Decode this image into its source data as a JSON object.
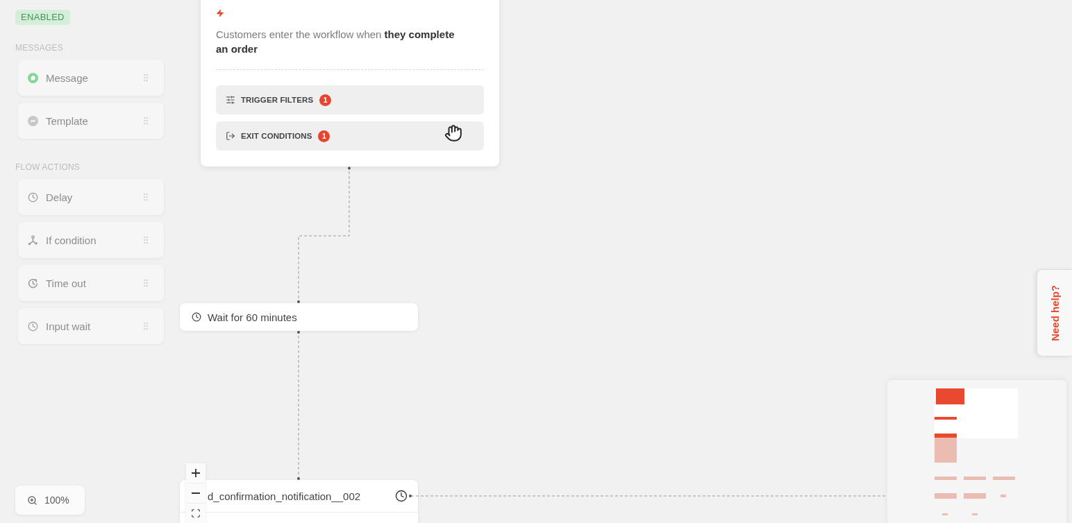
{
  "status_badge": {
    "label": "ENABLED",
    "on": true
  },
  "palette": [
    {
      "title": "MESSAGES",
      "items": [
        {
          "kind": "message",
          "label": "Message",
          "disabled": true
        },
        {
          "kind": "template",
          "label": "Template",
          "disabled": true
        }
      ]
    },
    {
      "title": "FLOW ACTIONS",
      "items": [
        {
          "kind": "delay",
          "label": "Delay",
          "disabled": true
        },
        {
          "kind": "condition",
          "label": "If condition",
          "disabled": true
        },
        {
          "kind": "timeout",
          "label": "Time out",
          "disabled": true
        },
        {
          "kind": "input_wait",
          "label": "Input wait",
          "disabled": true
        }
      ]
    }
  ],
  "zoom_indicator": {
    "label": "100%"
  },
  "trigger": {
    "description": "Customers enter the workflow when **they complete an order**",
    "rows": [
      {
        "kind": "filters",
        "label": "TRIGGER FILTERS",
        "count": "1"
      },
      {
        "kind": "exit",
        "label": "EXIT CONDITIONS",
        "count": "1"
      }
    ]
  },
  "nodes": [
    {
      "kind": "wait",
      "label": "Wait for 60 minutes"
    },
    {
      "kind": "message",
      "label": "d_confirmation_notification__002"
    }
  ],
  "help_tab": {
    "label": "Need help?"
  }
}
